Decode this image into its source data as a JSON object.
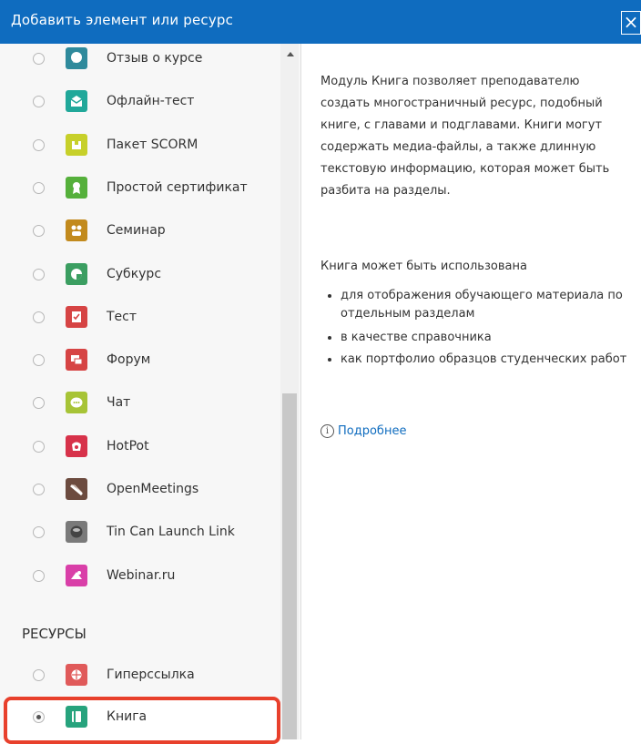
{
  "dialog": {
    "title": "Добавить элемент или ресурс",
    "close_label": "×"
  },
  "activities": [
    {
      "label": "Отзыв о курсе",
      "icon": "feedback-icon",
      "color": "#2f8a9c"
    },
    {
      "label": "Офлайн-тест",
      "icon": "offline-quiz-icon",
      "color": "#21a89a"
    },
    {
      "label": "Пакет SCORM",
      "icon": "scorm-icon",
      "color": "#c7d02a"
    },
    {
      "label": "Простой сертификат",
      "icon": "certificate-icon",
      "color": "#55b03b"
    },
    {
      "label": "Семинар",
      "icon": "workshop-icon",
      "color": "#c28a1d"
    },
    {
      "label": "Субкурс",
      "icon": "subcourse-icon",
      "color": "#3b9e61"
    },
    {
      "label": "Тест",
      "icon": "quiz-icon",
      "color": "#d64444"
    },
    {
      "label": "Форум",
      "icon": "forum-icon",
      "color": "#d64444"
    },
    {
      "label": "Чат",
      "icon": "chat-icon",
      "color": "#a7c437"
    },
    {
      "label": "HotPot",
      "icon": "hotpot-icon",
      "color": "#d7324a"
    },
    {
      "label": "OpenMeetings",
      "icon": "openmeetings-icon",
      "color": "#6c4b3f"
    },
    {
      "label": "Tin Can Launch Link",
      "icon": "tincan-icon",
      "color": "#7a7a7a"
    },
    {
      "label": "Webinar.ru",
      "icon": "webinar-icon",
      "color": "#d93fa8"
    }
  ],
  "resources_section": {
    "title": "РЕСУРСЫ",
    "items": [
      {
        "label": "Гиперссылка",
        "icon": "url-icon",
        "color": "#e05a5a"
      },
      {
        "label": "Книга",
        "icon": "book-icon",
        "color": "#27a37d",
        "selected": true
      }
    ]
  },
  "description": {
    "intro": "Модуль Книга позволяет преподавателю создать многостраничный ресурс, подобный книге, с главами и подглавами. Книги могут содержать медиа-файлы, а также длинную текстовую информацию, которая может быть разбита на разделы.",
    "usage_title": "Книга может быть использована",
    "bullets": [
      "для отображения обучающего материала по отдельным разделам",
      "в качестве справочника",
      "как портфолио образцов студенческих работ"
    ],
    "more_link": "Подробнее"
  }
}
